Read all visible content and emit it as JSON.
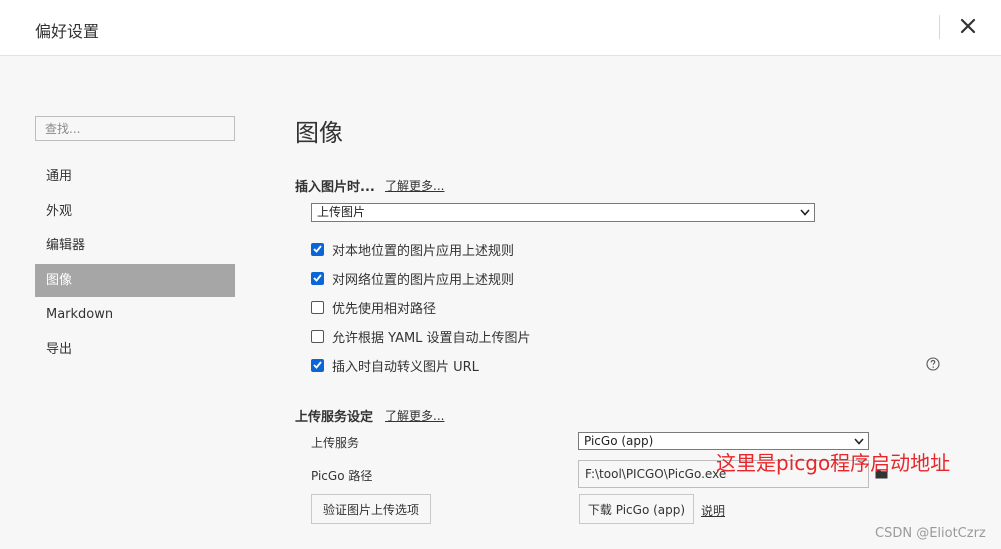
{
  "window": {
    "title": "偏好设置"
  },
  "sidebar": {
    "search_placeholder": "查找...",
    "items": [
      {
        "label": "通用",
        "active": false
      },
      {
        "label": "外观",
        "active": false
      },
      {
        "label": "编辑器",
        "active": false
      },
      {
        "label": "图像",
        "active": true
      },
      {
        "label": "Markdown",
        "active": false
      },
      {
        "label": "导出",
        "active": false
      }
    ]
  },
  "main": {
    "heading": "图像",
    "insert_section": {
      "label": "插入图片时...",
      "learn_more": "了解更多...",
      "selected_action": "上传图片"
    },
    "checkboxes": [
      {
        "label": "对本地位置的图片应用上述规则",
        "checked": true
      },
      {
        "label": "对网络位置的图片应用上述规则",
        "checked": true
      },
      {
        "label": "优先使用相对路径",
        "checked": false
      },
      {
        "label": "允许根据 YAML 设置自动上传图片",
        "checked": false
      },
      {
        "label": "插入时自动转义图片 URL",
        "checked": true
      }
    ],
    "upload_section": {
      "label": "上传服务设定",
      "learn_more": "了解更多...",
      "service_label": "上传服务",
      "service_value": "PicGo (app)",
      "path_label": "PicGo 路径",
      "path_value": "F:\\tool\\PICGO\\PicGo.exe",
      "verify_button": "验证图片上传选项",
      "download_button": "下载 PicGo (app)",
      "explain_link": "说明"
    }
  },
  "annotation": "这里是picgo程序启动地址",
  "watermark": "CSDN @EliotCzrz",
  "colors": {
    "accent": "#0a66d6",
    "active_nav": "#a6a6a6",
    "annotation": "#e8262a"
  }
}
